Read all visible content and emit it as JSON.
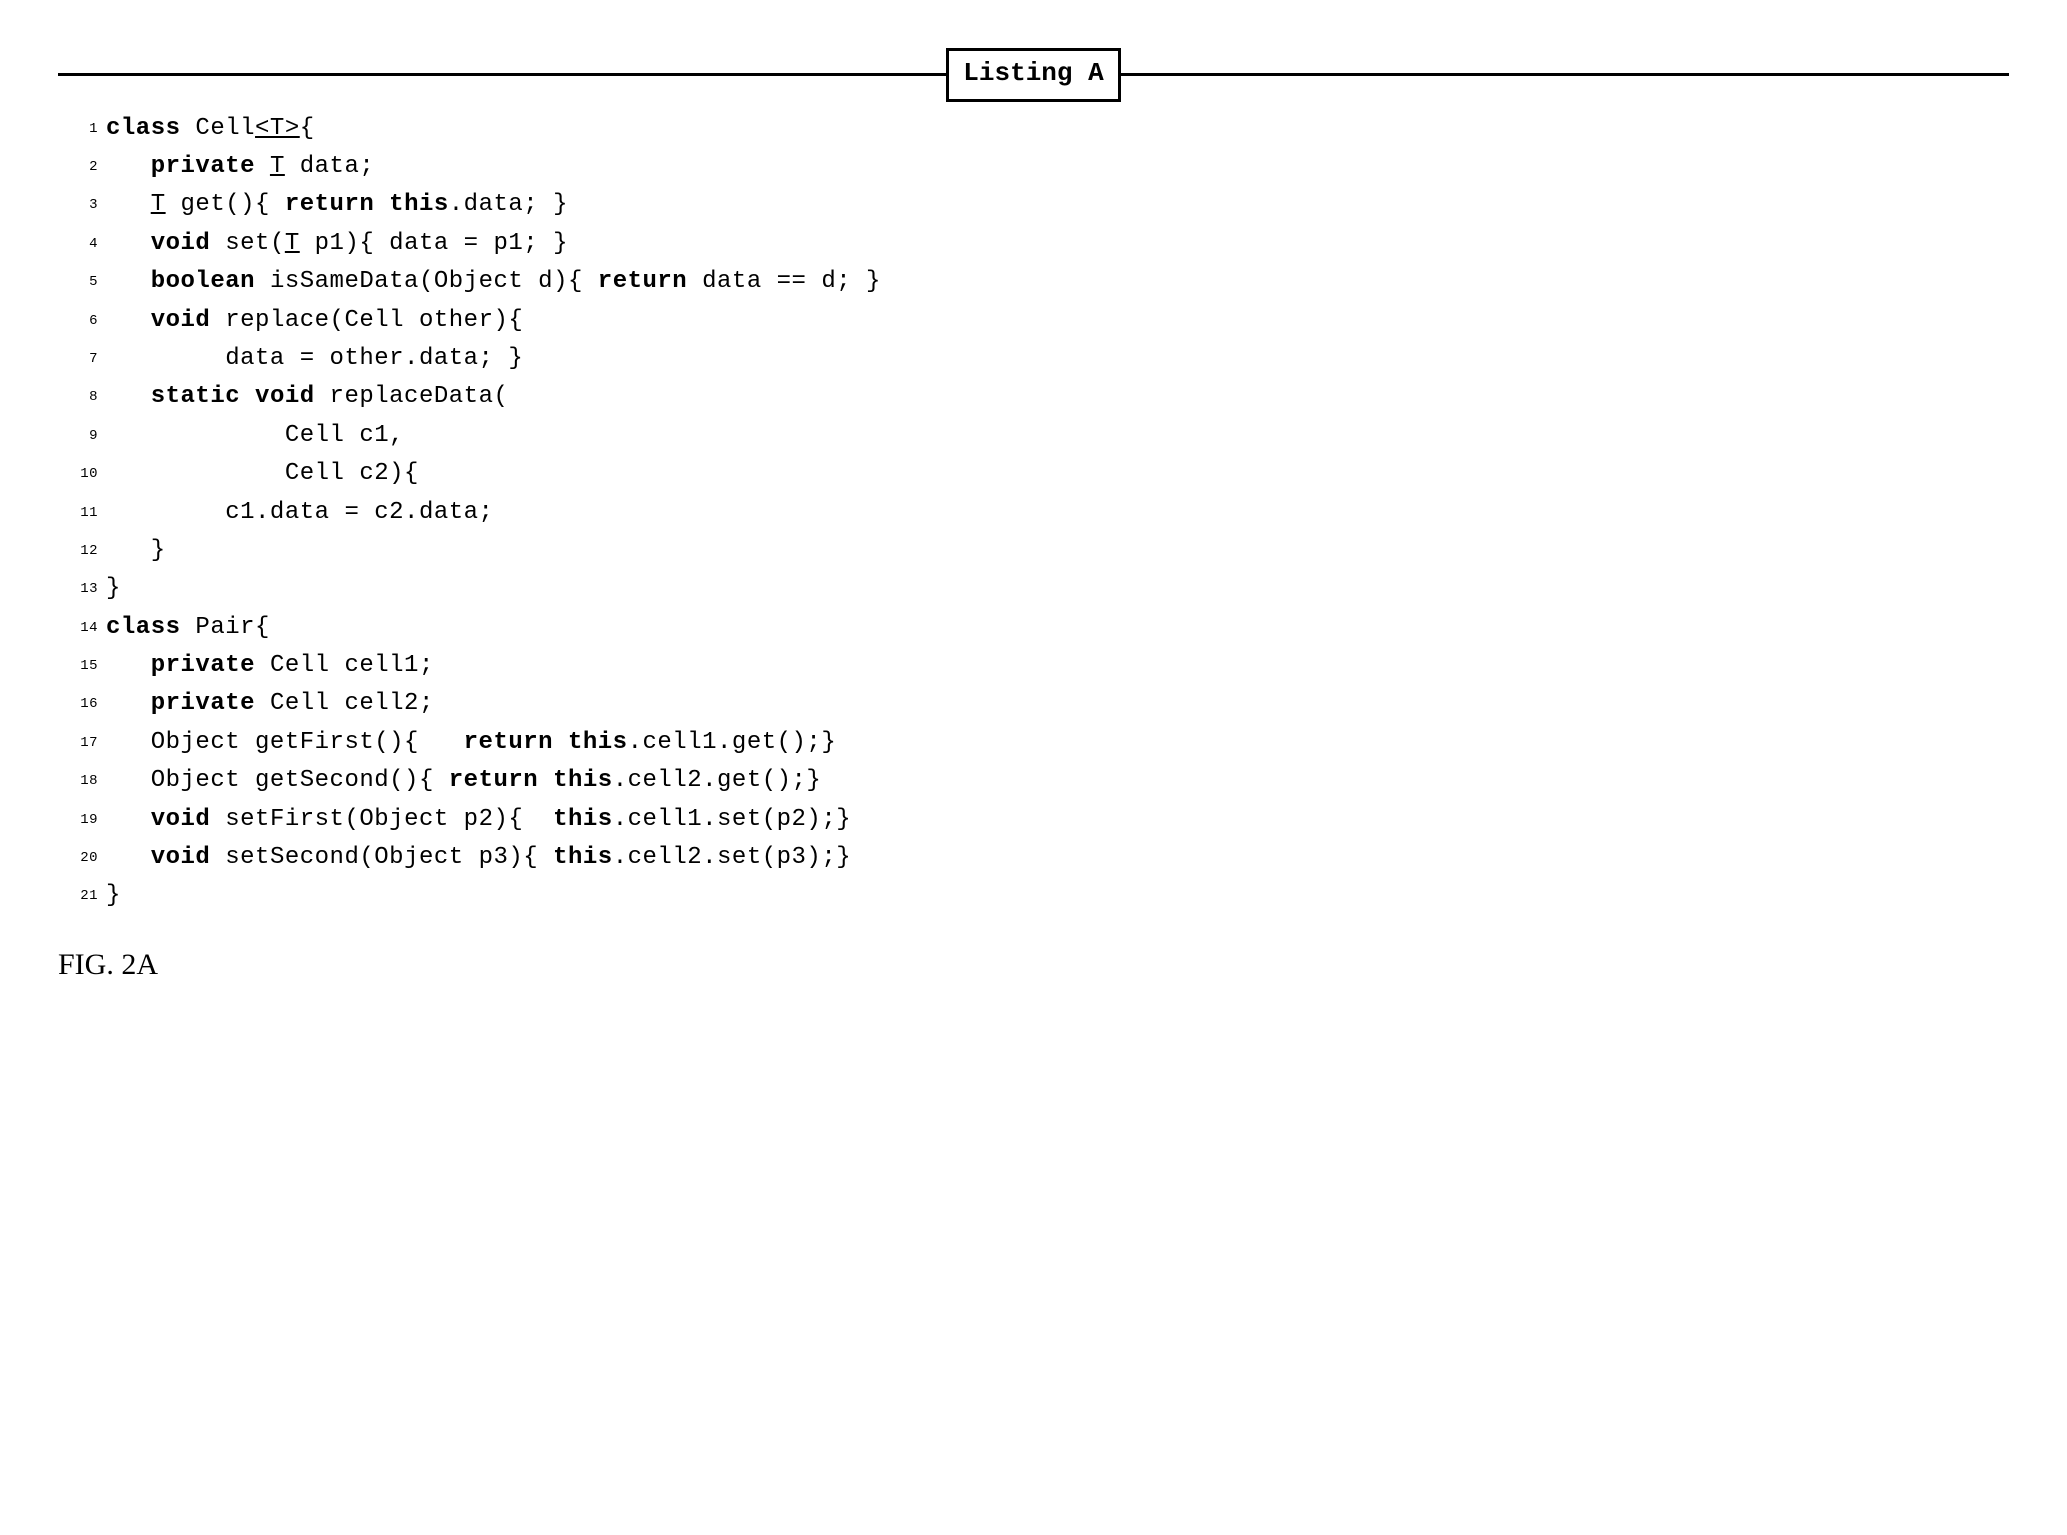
{
  "title": "Listing A",
  "figure_label": "FIG. 2A",
  "lines": [
    {
      "n": "1",
      "tokens": [
        {
          "t": "class ",
          "c": "kw"
        },
        {
          "t": "Cell"
        },
        {
          "t": "<T>",
          "c": "ul"
        },
        {
          "t": "{"
        }
      ]
    },
    {
      "n": "2",
      "tokens": [
        {
          "t": "   "
        },
        {
          "t": "private ",
          "c": "kw"
        },
        {
          "t": "T",
          "c": "ul"
        },
        {
          "t": " data;"
        }
      ]
    },
    {
      "n": "3",
      "tokens": [
        {
          "t": "   "
        },
        {
          "t": "T",
          "c": "ul"
        },
        {
          "t": " get(){ "
        },
        {
          "t": "return this",
          "c": "kw"
        },
        {
          "t": ".data; }"
        }
      ]
    },
    {
      "n": "4",
      "tokens": [
        {
          "t": "   "
        },
        {
          "t": "void ",
          "c": "kw"
        },
        {
          "t": "set("
        },
        {
          "t": "T",
          "c": "ul"
        },
        {
          "t": " p1){ data = p1; }"
        }
      ]
    },
    {
      "n": "5",
      "tokens": [
        {
          "t": "   "
        },
        {
          "t": "boolean ",
          "c": "kw"
        },
        {
          "t": "isSameData(Object d){ "
        },
        {
          "t": "return ",
          "c": "kw"
        },
        {
          "t": "data == d; }"
        }
      ]
    },
    {
      "n": "6",
      "tokens": [
        {
          "t": "   "
        },
        {
          "t": "void ",
          "c": "kw"
        },
        {
          "t": "replace(Cell other){"
        }
      ]
    },
    {
      "n": "7",
      "tokens": [
        {
          "t": "        data = other.data; }"
        }
      ]
    },
    {
      "n": "8",
      "tokens": [
        {
          "t": "   "
        },
        {
          "t": "static void ",
          "c": "kw"
        },
        {
          "t": "replaceData("
        }
      ]
    },
    {
      "n": "9",
      "tokens": [
        {
          "t": "            Cell c1,"
        }
      ]
    },
    {
      "n": "10",
      "tokens": [
        {
          "t": "            Cell c2){"
        }
      ]
    },
    {
      "n": "11",
      "tokens": [
        {
          "t": "        c1.data = c2.data;"
        }
      ]
    },
    {
      "n": "12",
      "tokens": [
        {
          "t": "   }"
        }
      ]
    },
    {
      "n": "13",
      "tokens": [
        {
          "t": "}"
        }
      ]
    },
    {
      "n": "14",
      "tokens": [
        {
          "t": "class ",
          "c": "kw"
        },
        {
          "t": "Pair{"
        }
      ]
    },
    {
      "n": "15",
      "tokens": [
        {
          "t": "   "
        },
        {
          "t": "private ",
          "c": "kw"
        },
        {
          "t": "Cell cell1;"
        }
      ]
    },
    {
      "n": "16",
      "tokens": [
        {
          "t": "   "
        },
        {
          "t": "private ",
          "c": "kw"
        },
        {
          "t": "Cell cell2;"
        }
      ]
    },
    {
      "n": "17",
      "tokens": [
        {
          "t": "   Object getFirst(){   "
        },
        {
          "t": "return this",
          "c": "kw"
        },
        {
          "t": ".cell1.get();}"
        }
      ]
    },
    {
      "n": "18",
      "tokens": [
        {
          "t": "   Object getSecond(){ "
        },
        {
          "t": "return this",
          "c": "kw"
        },
        {
          "t": ".cell2.get();}"
        }
      ]
    },
    {
      "n": "19",
      "tokens": [
        {
          "t": "   "
        },
        {
          "t": "void ",
          "c": "kw"
        },
        {
          "t": "setFirst(Object p2){  "
        },
        {
          "t": "this",
          "c": "kw"
        },
        {
          "t": ".cell1.set(p2);}"
        }
      ]
    },
    {
      "n": "20",
      "tokens": [
        {
          "t": "   "
        },
        {
          "t": "void ",
          "c": "kw"
        },
        {
          "t": "setSecond(Object p3){ "
        },
        {
          "t": "this",
          "c": "kw"
        },
        {
          "t": ".cell2.set(p3);}"
        }
      ]
    },
    {
      "n": "21",
      "tokens": [
        {
          "t": "}"
        }
      ]
    }
  ]
}
